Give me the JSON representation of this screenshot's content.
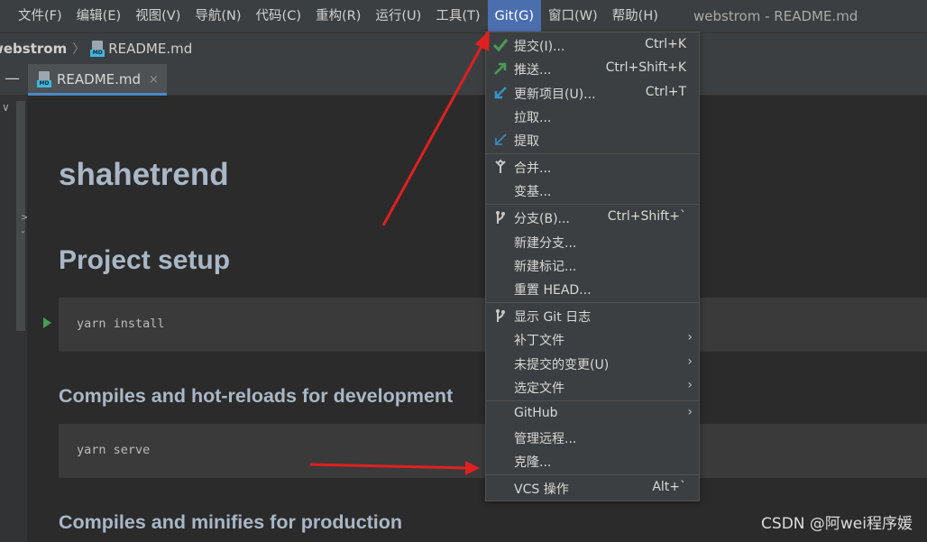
{
  "menubar": {
    "items": [
      "文件(F)",
      "编辑(E)",
      "视图(V)",
      "导航(N)",
      "代码(C)",
      "重构(R)",
      "运行(U)",
      "工具(T)",
      "Git(G)",
      "窗口(W)",
      "帮助(H)"
    ],
    "active": "Git(G)",
    "window_title": "webstrom - README.md"
  },
  "breadcrumb": {
    "project": "webstrom",
    "file": "README.md"
  },
  "tabs": [
    {
      "label": "README.md",
      "close": "×",
      "icon_tag": "MD"
    }
  ],
  "editor": {
    "h1": "shahetrend",
    "h2": "Project setup",
    "code1": "yarn install",
    "h3a": "Compiles and hot-reloads for development",
    "code2": "yarn serve",
    "h3b": "Compiles and minifies for production"
  },
  "git_menu": {
    "commit": {
      "label": "提交(I)...",
      "shortcut": "Ctrl+K",
      "icon": "check-icon"
    },
    "push": {
      "label": "推送...",
      "shortcut": "Ctrl+Shift+K",
      "icon": "push-arrow-icon"
    },
    "update": {
      "label": "更新项目(U)...",
      "shortcut": "Ctrl+T",
      "icon": "update-arrow-icon"
    },
    "pull": {
      "label": "拉取..."
    },
    "fetch": {
      "label": "提取",
      "icon": "fetch-icon"
    },
    "merge": {
      "label": "合并...",
      "icon": "merge-icon"
    },
    "rebase": {
      "label": "变基..."
    },
    "branches": {
      "label": "分支(B)...",
      "shortcut": "Ctrl+Shift+`",
      "icon": "branch-icon"
    },
    "new_branch": {
      "label": "新建分支..."
    },
    "new_tag": {
      "label": "新建标记..."
    },
    "reset_head": {
      "label": "重置 HEAD..."
    },
    "show_log": {
      "label": "显示 Git 日志",
      "icon": "branch-icon"
    },
    "patch": {
      "label": "补丁文件"
    },
    "uncommitted": {
      "label": "未提交的变更(U)"
    },
    "current_file": {
      "label": "选定文件"
    },
    "github": {
      "label": "GitHub"
    },
    "remotes": {
      "label": "管理远程..."
    },
    "clone": {
      "label": "克隆..."
    },
    "vcs_ops": {
      "label": "VCS 操作",
      "shortcut": "Alt+`"
    },
    "submenu_glyph": "›"
  },
  "colors": {
    "accent": "#4b6eaf",
    "annotation": "#e02020",
    "check": "#499c54",
    "blue_arrow": "#3592c4"
  },
  "watermark": "CSDN @阿wei程序媛"
}
